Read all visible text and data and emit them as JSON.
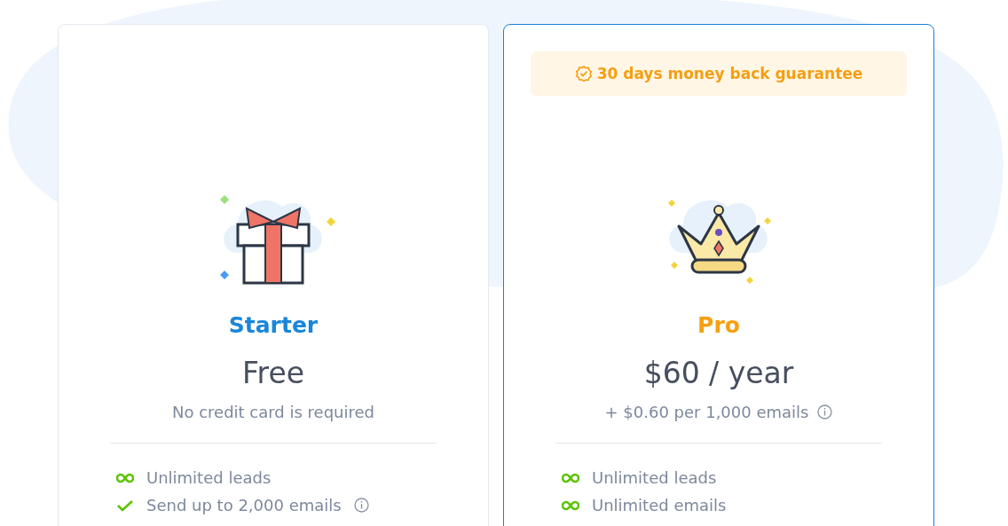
{
  "plans": [
    {
      "kind": "gift",
      "name": "Starter",
      "highlighted": false,
      "price": "Free",
      "note": "No credit card is required",
      "note_info": false,
      "features": [
        {
          "kind": "infinity",
          "text": "Unlimited leads",
          "info": false
        },
        {
          "kind": "check",
          "text": "Send up to 2,000 emails",
          "info": true
        }
      ]
    },
    {
      "kind": "crown",
      "name": "Pro",
      "highlighted": true,
      "banner": "30 days money back guarantee",
      "price": "$60 / year",
      "note": "+ $0.60 per 1,000 emails",
      "note_info": true,
      "features": [
        {
          "kind": "infinity",
          "text": "Unlimited leads",
          "info": false
        },
        {
          "kind": "infinity",
          "text": "Unlimited emails",
          "info": false
        }
      ]
    }
  ]
}
